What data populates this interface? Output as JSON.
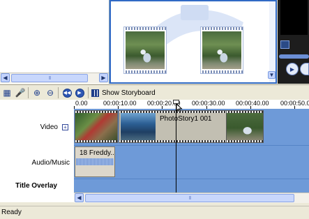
{
  "timeline_toolbar": {
    "show_storyboard_label": "Show Storyboard",
    "icons": [
      "storyboard-icon",
      "microphone-icon",
      "zoom-in-icon",
      "zoom-out-icon",
      "rewind-icon",
      "play-icon",
      "storyboard-toggle-icon"
    ]
  },
  "ruler": {
    "ticks": [
      "0.00",
      "00:00:10.00",
      "00:00:20.00",
      "00:00:30.00",
      "00:00:40.00",
      "00:00:50.0"
    ]
  },
  "tracks": {
    "video_label": "Video",
    "video_expand": "+",
    "audio_label": "Audio/Music",
    "title_label": "Title Overlay"
  },
  "clips": {
    "video_clip_title": "PhotoStory1 001",
    "audio_clip_title": "18 Freddy..."
  },
  "status": {
    "text": "Ready"
  },
  "colors": {
    "track_blue": "#6e9ad8",
    "selection_border": "#316ac5",
    "window_bg": "#ece9d8"
  }
}
